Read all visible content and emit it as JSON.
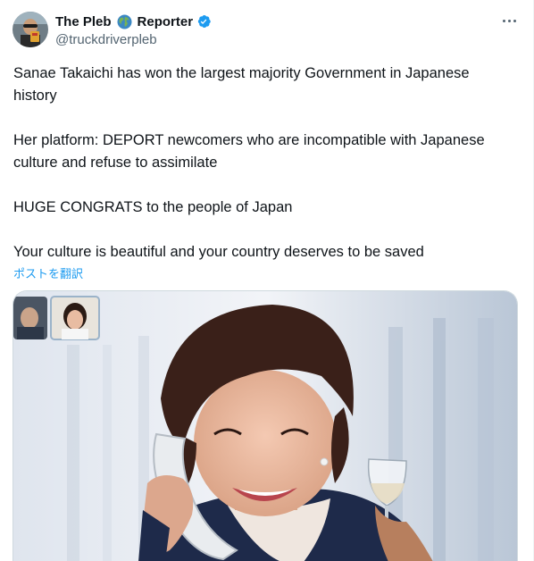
{
  "author": {
    "display_name_part1": "The Pleb",
    "display_name_part2": "Reporter",
    "handle": "@truckdriverpleb",
    "globe_icon": "globe-emoji-icon",
    "verified_icon": "verified-badge-icon",
    "verified_color": "#1d9bf0"
  },
  "tweet": {
    "paragraphs": [
      "Sanae Takaichi has won the largest majority Government in Japanese\nhistory",
      "Her platform: DEPORT newcomers who are incompatible with Japanese\nculture and refuse to assimilate",
      "HUGE CONGRATS to the people of Japan",
      "Your culture is beautiful and your country deserves to be saved"
    ],
    "translate_label": "ポストを翻訳"
  },
  "colors": {
    "text": "#0f1419",
    "secondary": "#536471",
    "link": "#1d9bf0"
  }
}
